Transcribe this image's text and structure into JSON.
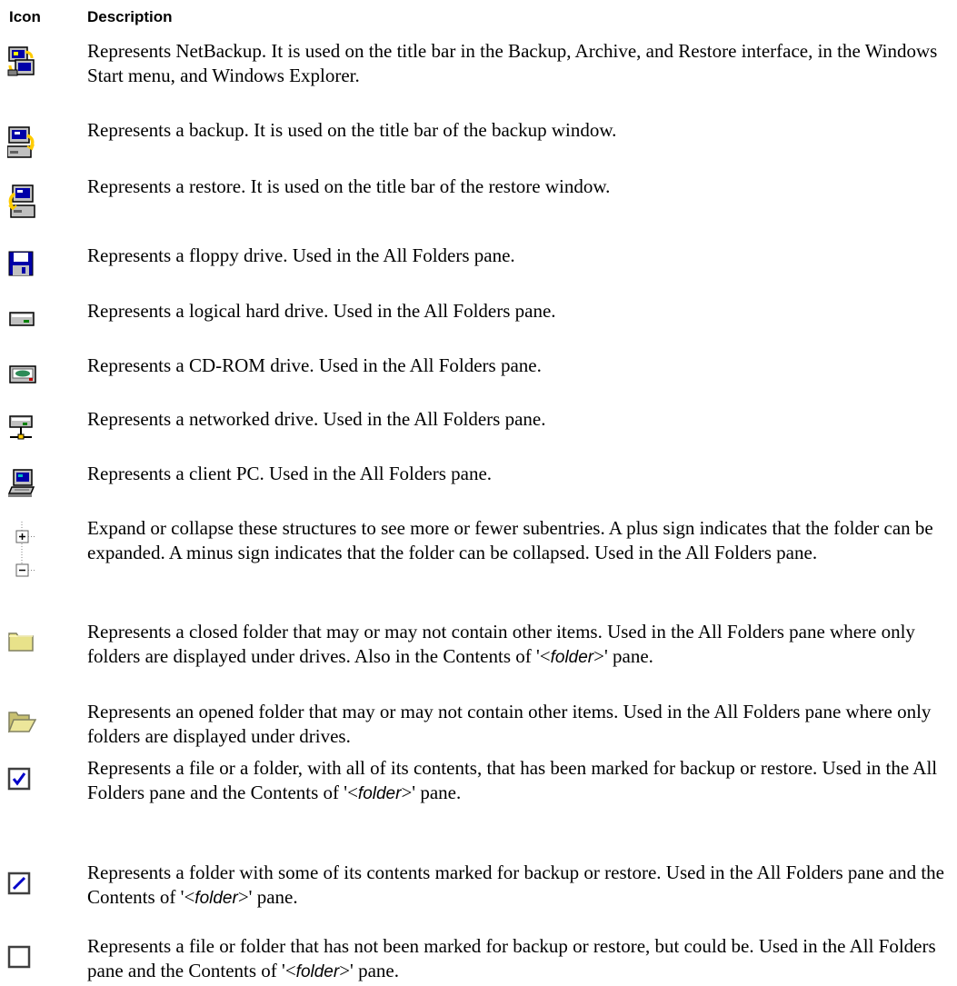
{
  "header": {
    "icon_label": "Icon",
    "description_label": "Description"
  },
  "rows": [
    {
      "icon": "netbackup-icon",
      "text": "Represents NetBackup. It is used on the title bar in the Backup, Archive, and Restore interface, in the Windows Start menu, and Windows Explorer."
    },
    {
      "icon": "backup-window-icon",
      "text": "Represents a backup. It is used on the title bar of the backup window."
    },
    {
      "icon": "restore-window-icon",
      "text": "Represents a restore. It is used on the title bar of the restore window."
    },
    {
      "icon": "floppy-drive-icon",
      "text": "Represents a floppy drive. Used in the All Folders pane."
    },
    {
      "icon": "hard-drive-icon",
      "text": "Represents a logical hard drive. Used in the All Folders pane."
    },
    {
      "icon": "cdrom-drive-icon",
      "text": "Represents a CD-ROM drive. Used in the All Folders pane."
    },
    {
      "icon": "network-drive-icon",
      "text": "Represents a networked drive. Used in the All Folders pane."
    },
    {
      "icon": "client-pc-icon",
      "text": "Represents a client PC. Used in the All Folders pane."
    },
    {
      "icon": "expand-collapse-icon",
      "text": "Expand or collapse these structures to see more or fewer subentries. A plus sign indicates that the folder can be expanded. A minus sign indicates that the folder can be collapsed. Used in the All Folders pane."
    },
    {
      "icon": "closed-folder-icon",
      "pre": "Represents a closed folder that may or may not contain other items. Used in the All Folders pane where only folders are displayed under drives. Also in the Contents of '<",
      "italic": "folder",
      "post": ">' pane."
    },
    {
      "icon": "open-folder-icon",
      "text": "Represents an opened folder that may or may not contain other items. Used in the All Folders pane where only folders are displayed under drives."
    },
    {
      "icon": "checked-checkbox-icon",
      "pre": "Represents a file or a folder, with all of its contents, that has been marked for backup or restore. Used in the All Folders pane and the Contents of '<",
      "italic": "folder",
      "post": ">' pane."
    },
    {
      "icon": "partial-checkbox-icon",
      "pre": "Represents a folder with some of its contents marked for backup or restore. Used in the All Folders pane and the Contents of '<",
      "italic": "folder",
      "post": ">' pane."
    },
    {
      "icon": "empty-checkbox-icon",
      "pre": "Represents a file or folder that has not been marked for backup or restore, but could be. Used in the All Folders pane and the Contents of '<",
      "italic": "folder",
      "post": ">' pane."
    }
  ]
}
